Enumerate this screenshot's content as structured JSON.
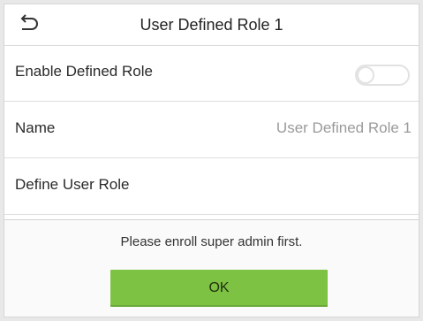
{
  "header": {
    "title": "User Defined Role 1",
    "back_icon": "back-arrow-icon"
  },
  "rows": [
    {
      "label": "Enable Defined Role",
      "toggle_on": false
    },
    {
      "label": "Name",
      "value": "User Defined Role 1"
    },
    {
      "label": "Define User Role"
    }
  ],
  "dialog": {
    "message": "Please enroll super admin first.",
    "ok_label": "OK"
  },
  "colors": {
    "ok_button": "#7dc242"
  }
}
